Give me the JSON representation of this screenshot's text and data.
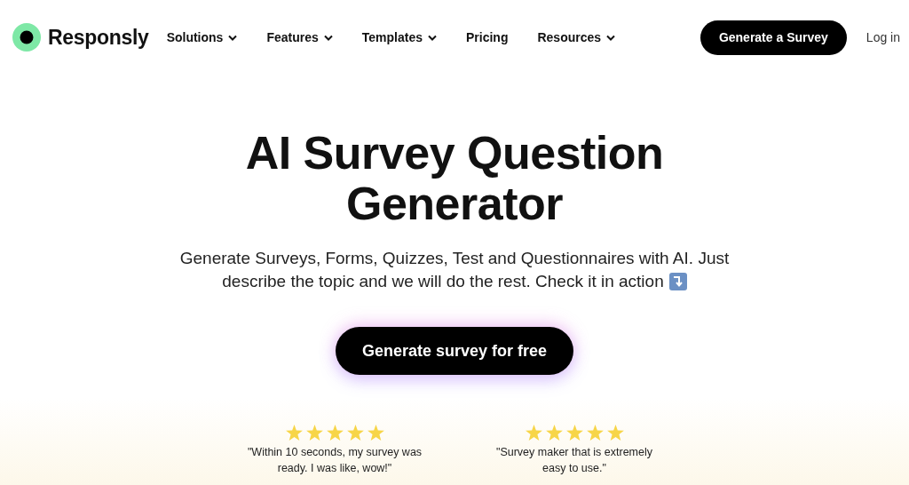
{
  "brand": "Responsly",
  "nav": [
    {
      "label": "Solutions",
      "dropdown": true
    },
    {
      "label": "Features",
      "dropdown": true
    },
    {
      "label": "Templates",
      "dropdown": true
    },
    {
      "label": "Pricing",
      "dropdown": false
    },
    {
      "label": "Resources",
      "dropdown": true
    }
  ],
  "cta": "Generate a Survey",
  "login": "Log in",
  "hero": {
    "title": "AI Survey Question Generator",
    "description": [
      "Generate Surveys, Forms, Quizzes, Test and Questionnaires with AI. Just",
      "describe the topic and we will do the rest. Check it in action"
    ],
    "button": "Generate survey for free"
  },
  "reviews": [
    {
      "stars": 5,
      "quote": "\"Within 10 seconds, my survey was ready. I was like, wow!\""
    },
    {
      "stars": 5,
      "quote": "\"Survey maker that is extremely easy to use.\""
    }
  ]
}
